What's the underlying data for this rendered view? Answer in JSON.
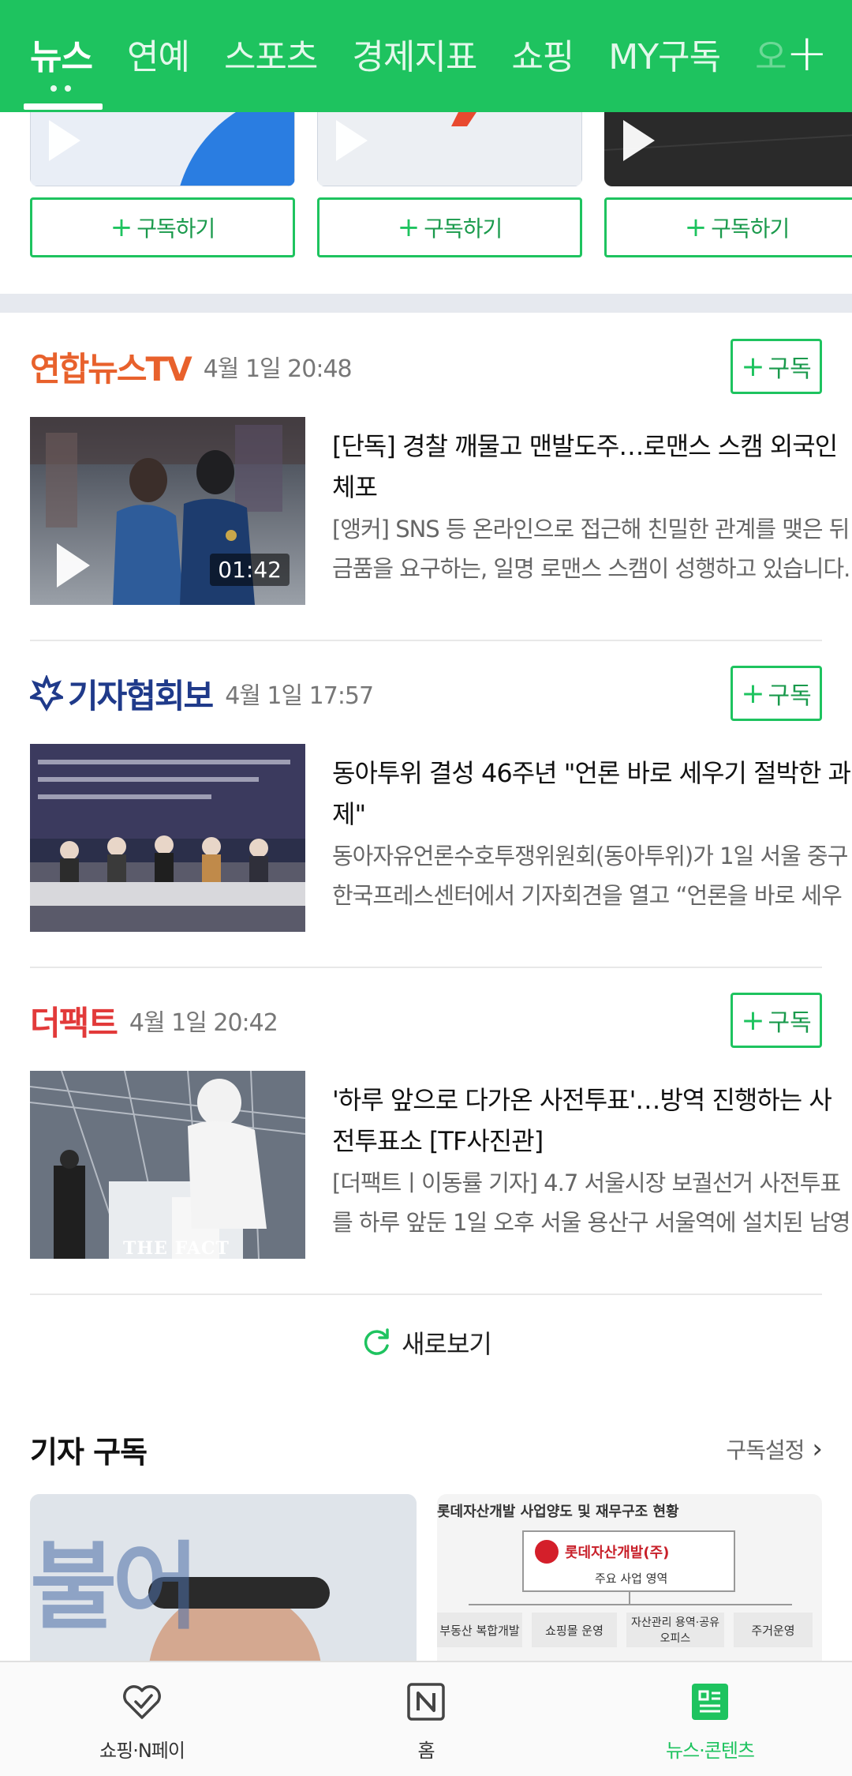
{
  "topnav": {
    "tabs": [
      "뉴스",
      "연예",
      "스포츠",
      "경제지표",
      "쇼핑",
      "MY구독",
      "오"
    ],
    "add_label": "+"
  },
  "channels": [
    {
      "subscribe_label": "구독하기"
    },
    {
      "subscribe_label": "구독하기"
    },
    {
      "subscribe_label": "구독하기"
    }
  ],
  "news": [
    {
      "press": "연합뉴스TV",
      "time": "4월 1일 20:48",
      "follow_label": "구독",
      "title": "[단독] 경찰 깨물고 맨발도주…로맨스 스캠 외국인 체포",
      "desc": "[앵커] SNS 등 온라인으로 접근해 친밀한 관계를 맺은 뒤 금품을 요구하는, 일명 로맨스 스캠이 성행하고 있습니다. …",
      "duration": "01:42"
    },
    {
      "press": "기자협회보",
      "time": "4월 1일 17:57",
      "follow_label": "구독",
      "title": "동아투위 결성 46주년 \"언론 바로 세우기 절박한 과제\"",
      "desc": "동아자유언론수호투쟁위원회(동아투위)가 1일 서울 중구 한국프레스센터에서 기자회견을 열고 “언론을 바로 세우는 …"
    },
    {
      "press": "더팩트",
      "time": "4월 1일 20:42",
      "follow_label": "구독",
      "title": "'하루 앞으로 다가온 사전투표'…방역 진행하는 사전투표소 [TF사진관]",
      "desc": "[더팩트ㅣ이동률 기자] 4.7 서울시장 보궐선거 사전투표를 하루 앞둔 1일 오후 서울 용산구 서울역에 설치된 남영동 사…",
      "watermark": "THE FACT"
    }
  ],
  "refresh_label": "새로보기",
  "reporter": {
    "title": "기자 구독",
    "setting_label": "구독설정",
    "card2": {
      "heading": "롯데자산개발 사업양도 및 재무구조 현황",
      "company": "롯데자산개발(주)",
      "sub": "주요 사업 영역",
      "boxes": [
        "부동산 복합개발",
        "쇼핑몰 운영",
        "자산관리 용역·공유오피스",
        "주거운영"
      ]
    },
    "card1_text": "불어"
  },
  "bottomnav": [
    {
      "label": "쇼핑·N페이"
    },
    {
      "label": "홈"
    },
    {
      "label": "뉴스·콘텐츠"
    }
  ],
  "colors": {
    "brand_green": "#1ec35f",
    "press_orange": "#e8612c",
    "press_navy": "#1f3a8a",
    "press_red": "#e23a3a"
  }
}
